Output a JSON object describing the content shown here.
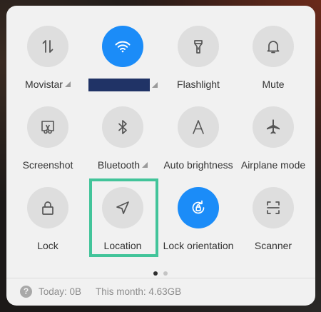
{
  "quick_settings": {
    "tiles": [
      {
        "id": "mobile-data",
        "label": "Movistar",
        "icon": "data-arrows-icon",
        "active": false,
        "has_menu": true
      },
      {
        "id": "wifi",
        "label": "",
        "label_redacted": true,
        "icon": "wifi-icon",
        "active": true,
        "has_menu": true
      },
      {
        "id": "flashlight",
        "label": "Flashlight",
        "icon": "flashlight-icon",
        "active": false
      },
      {
        "id": "mute",
        "label": "Mute",
        "icon": "bell-icon",
        "active": false
      },
      {
        "id": "screenshot",
        "label": "Screenshot",
        "icon": "screenshot-scissors-icon",
        "active": false
      },
      {
        "id": "bluetooth",
        "label": "Bluetooth",
        "icon": "bluetooth-icon",
        "active": false,
        "has_menu": true
      },
      {
        "id": "auto-brightness",
        "label": "Auto brightness",
        "icon": "letter-a-icon",
        "active": false
      },
      {
        "id": "airplane-mode",
        "label": "Airplane mode",
        "icon": "airplane-icon",
        "active": false
      },
      {
        "id": "lock",
        "label": "Lock",
        "icon": "lock-icon",
        "active": false
      },
      {
        "id": "location",
        "label": "Location",
        "icon": "location-arrow-icon",
        "active": false,
        "highlighted": true
      },
      {
        "id": "lock-orientation",
        "label": "Lock orientation",
        "icon": "rotation-lock-icon",
        "active": true
      },
      {
        "id": "scanner",
        "label": "Scanner",
        "icon": "scanner-icon",
        "active": false
      }
    ],
    "page_indicator": {
      "pages": 2,
      "current": 1
    }
  },
  "usage": {
    "help_glyph": "?",
    "today": "Today: 0B",
    "month": "This month: 4.63GB"
  },
  "colors": {
    "active": "#1b8cf8",
    "inactive": "#dedede",
    "panel": "#f1f1f1",
    "highlight": "#42c49a",
    "redacted": "#203366"
  }
}
